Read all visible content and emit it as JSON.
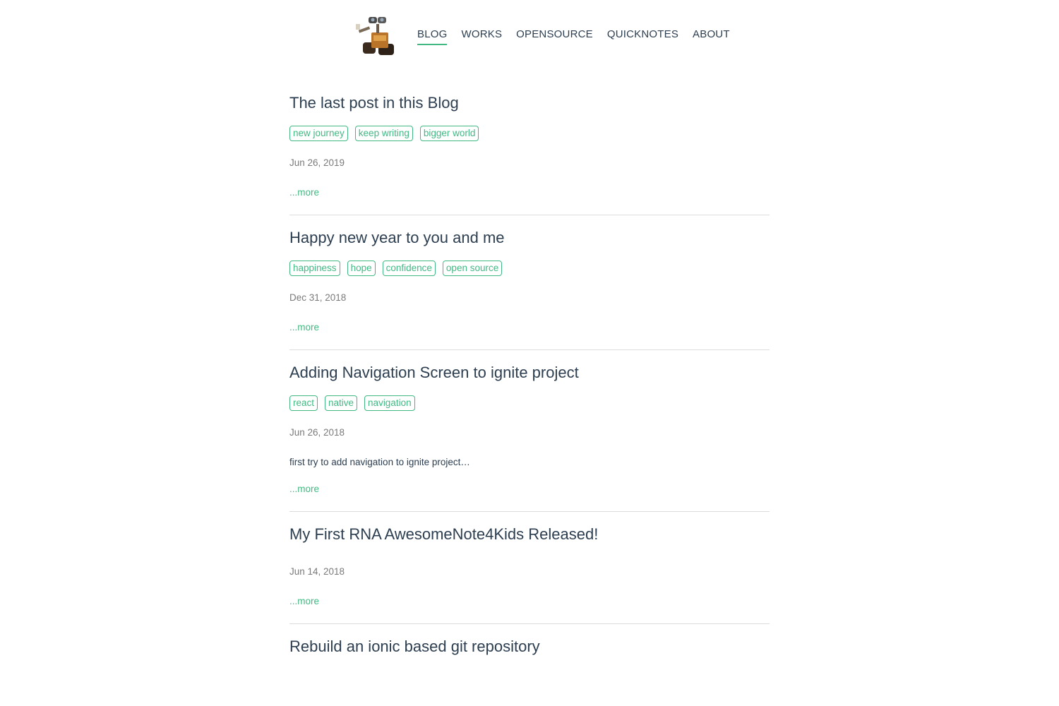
{
  "nav": {
    "items": [
      {
        "label": "BLOG",
        "active": true
      },
      {
        "label": "WORKS",
        "active": false
      },
      {
        "label": "OPENSOURCE",
        "active": false
      },
      {
        "label": "QUICKNOTES",
        "active": false
      },
      {
        "label": "ABOUT",
        "active": false
      }
    ]
  },
  "colors": {
    "accent": "#42b983",
    "text": "#2c3e50",
    "muted": "#7a7a7a",
    "divider": "#dcdcdc"
  },
  "posts": [
    {
      "title": "The last post in this Blog",
      "tags": [
        "new journey",
        "keep writing",
        "bigger world"
      ],
      "date": "Jun 26, 2019",
      "excerpt": "",
      "more": "...more"
    },
    {
      "title": "Happy new year to you and me",
      "tags": [
        "happiness",
        "hope",
        "confidence",
        "open source"
      ],
      "date": "Dec 31, 2018",
      "excerpt": "",
      "more": "...more"
    },
    {
      "title": "Adding Navigation Screen to ignite project",
      "tags": [
        "react",
        "native",
        "navigation"
      ],
      "date": "Jun 26, 2018",
      "excerpt": "first try to add navigation to ignite project…",
      "more": "...more"
    },
    {
      "title": "My First RNA AwesomeNote4Kids Released!",
      "tags": [],
      "date": "Jun 14, 2018",
      "excerpt": "",
      "more": "...more"
    },
    {
      "title": "Rebuild an ionic based git repository",
      "tags": [],
      "date": "",
      "excerpt": "",
      "more": ""
    }
  ]
}
